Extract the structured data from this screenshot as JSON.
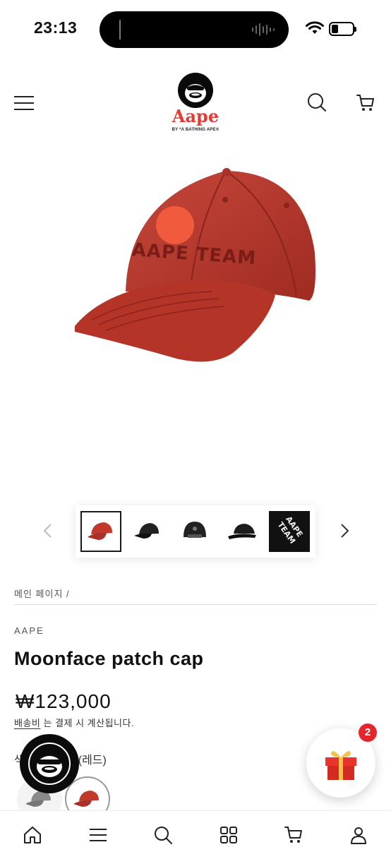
{
  "status_bar": {
    "time": "23:13"
  },
  "header": {
    "logo_text": "Aape",
    "logo_sub": "BY *A BATHING APE®"
  },
  "thumbnails": [
    {
      "name": "red-cap",
      "color": "#c0392b",
      "active": true
    },
    {
      "name": "black-cap-side",
      "color": "#222222",
      "active": false
    },
    {
      "name": "black-cap-back",
      "color": "#222222",
      "active": false
    },
    {
      "name": "black-cap-low",
      "color": "#1c1c1c",
      "active": false
    },
    {
      "name": "black-cap-embroidery",
      "color": "#1a1a1a",
      "active": false
    }
  ],
  "product": {
    "breadcrumb": "메인 페이지 /",
    "vendor": "AAPE",
    "title": "Moonface patch cap",
    "price": "₩123,000",
    "shipping_link": "배송비",
    "shipping_text": " 는 결제 시 계산됩니다.",
    "color_label_prefix": "색",
    "color_label_value": "(레드)"
  },
  "swatches": [
    {
      "name": "grey",
      "color": "#8a8a8a",
      "active": false
    },
    {
      "name": "red",
      "color": "#c0392b",
      "active": true
    }
  ],
  "gift": {
    "badge_count": "2"
  },
  "colors": {
    "brand_red": "#e63a34",
    "badge_red": "#e3262c",
    "cap_red": "#b93a2e"
  }
}
